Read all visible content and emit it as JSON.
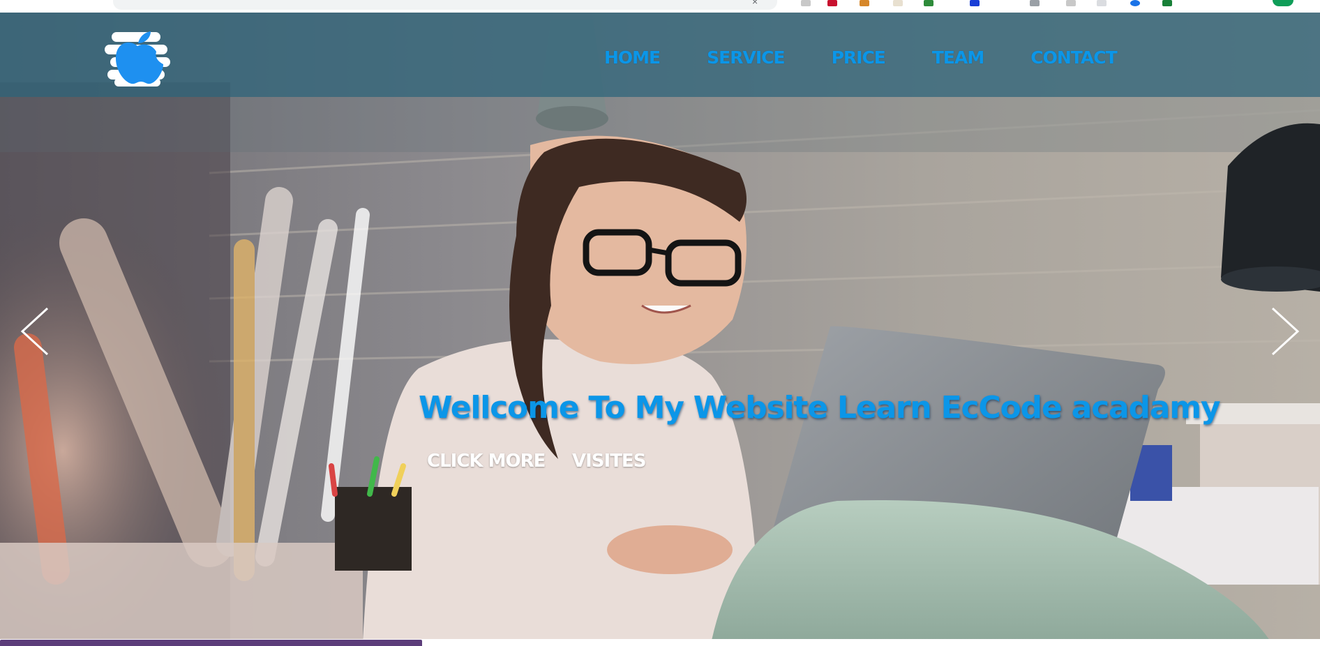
{
  "browser": {
    "extension_colors": [
      "#c8102e",
      "#3a3a3a",
      "#d6872a",
      "#e8e0d0",
      "#2e8b3a",
      "#1a3fd6",
      "#5f6368",
      "#9aa0a6",
      "#1a73e8",
      "#188038",
      "#0f9d58"
    ]
  },
  "header": {
    "logo_icon": "apple-logo-icon",
    "nav": [
      {
        "label": "HOME"
      },
      {
        "label": "SERVICE"
      },
      {
        "label": "PRICE"
      },
      {
        "label": "TEAM"
      },
      {
        "label": "CONTACT"
      }
    ],
    "nav_color": "#0b96e8"
  },
  "hero": {
    "headline": "Wellcome To My Website Learn EcCode acadamy",
    "buttons": {
      "more": "CLICK MORE",
      "visits": "VISITES"
    },
    "prev_icon": "chevron-left-icon",
    "next_icon": "chevron-right-icon"
  },
  "page_progress": 0.32
}
